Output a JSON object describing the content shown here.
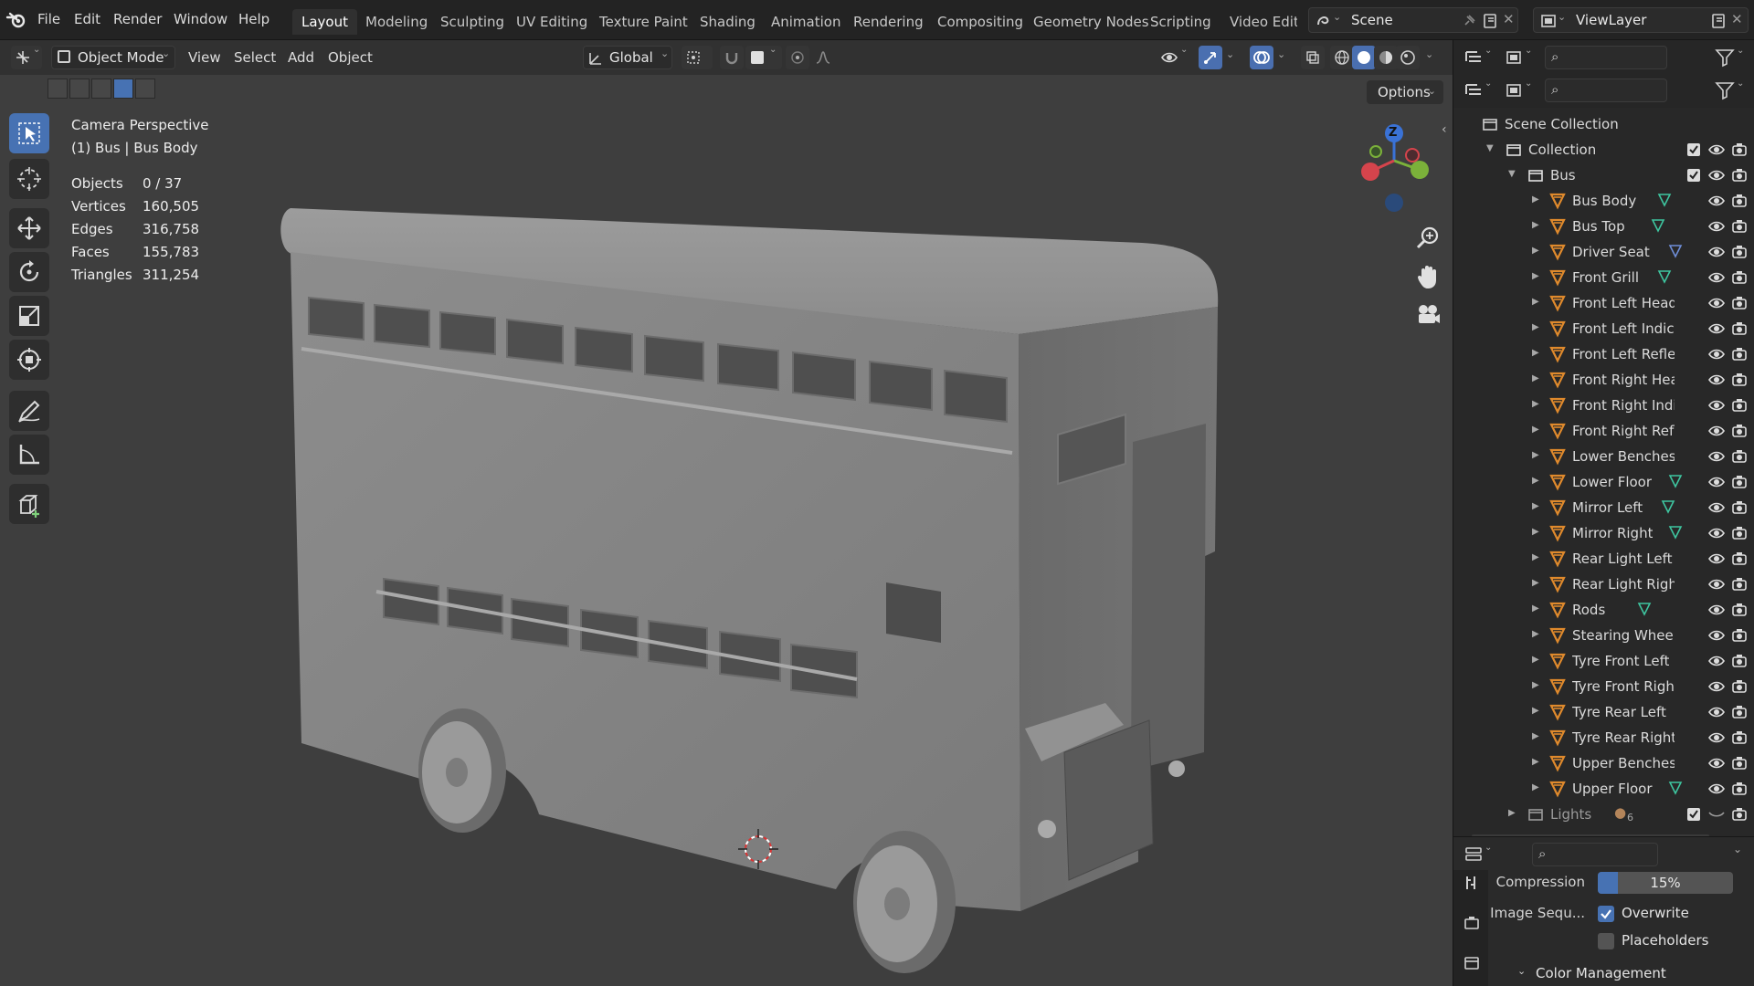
{
  "app": {
    "menus": [
      "File",
      "Edit",
      "Render",
      "Window",
      "Help"
    ],
    "workspaces": [
      "Layout",
      "Modeling",
      "Sculpting",
      "UV Editing",
      "Texture Paint",
      "Shading",
      "Animation",
      "Rendering",
      "Compositing",
      "Geometry Nodes",
      "Scripting",
      "Video Editi"
    ],
    "active_workspace": "Layout",
    "scene_name": "Scene",
    "view_layer_name": "ViewLayer"
  },
  "viewport": {
    "mode": "Object Mode",
    "menus": [
      "View",
      "Select",
      "Add",
      "Object"
    ],
    "transform_orientation": "Global",
    "options_label": "Options",
    "view_name": "Camera Perspective",
    "active_object": "(1) Bus | Bus Body",
    "stats": [
      {
        "label": "Objects",
        "value": "0 / 37"
      },
      {
        "label": "Vertices",
        "value": "160,505"
      },
      {
        "label": "Edges",
        "value": "316,758"
      },
      {
        "label": "Faces",
        "value": "155,783"
      },
      {
        "label": "Triangles",
        "value": "311,254"
      }
    ],
    "gizmo_axis_label": "Z",
    "accent_color": "#4772b3"
  },
  "outliner": {
    "scene_collection": "Scene Collection",
    "collection": "Collection",
    "bus_collection": "Bus",
    "objects": [
      "Bus Body",
      "Bus Top",
      "Driver Seat",
      "Front Grill",
      "Front Left Head Li",
      "Front Left Indicatc",
      "Front Left Reflectc",
      "Front Right Head I",
      "Front Right Indicat",
      "Front Right Reflec",
      "Lower Benches ne",
      "Lower Floor",
      "Mirror Left",
      "Mirror Right",
      "Rear Light Left",
      "Rear Light Right",
      "Rods",
      "Stearing Wheel",
      "Tyre Front Left",
      "Tyre Front Right",
      "Tyre Rear Left",
      "Tyre Rear Right",
      "Upper Benches N",
      "Upper Floor"
    ],
    "lights_collection": "Lights",
    "lights_count": "6"
  },
  "properties": {
    "compression_label": "Compression",
    "compression_value": "15%",
    "compression_fraction": 0.15,
    "image_sequence_label": "Image Sequ...",
    "overwrite_label": "Overwrite",
    "overwrite_checked": true,
    "placeholders_label": "Placeholders",
    "placeholders_checked": false,
    "color_management_label": "Color Management"
  }
}
